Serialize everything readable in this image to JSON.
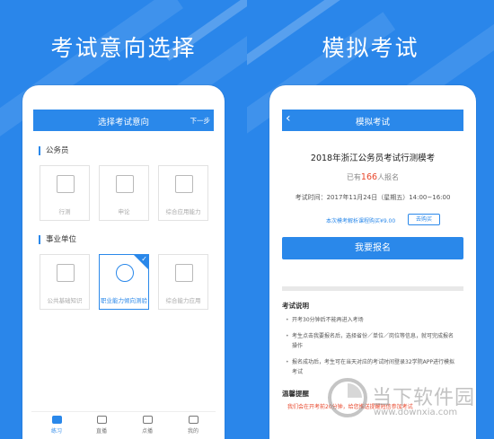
{
  "left_panel": {
    "headline": "考试意向选择",
    "header": {
      "title": "选择考试意向",
      "next": "下一步"
    },
    "section1": {
      "title": "公务员",
      "items": [
        {
          "label": "行测"
        },
        {
          "label": "申论"
        },
        {
          "label": "综合应用能力"
        }
      ]
    },
    "section2": {
      "title": "事业单位",
      "items": [
        {
          "label": "公共基础知识"
        },
        {
          "label": "职业能力倾向测验",
          "selected": true
        },
        {
          "label": "综合能力应用"
        }
      ]
    },
    "tabs": [
      {
        "label": "练习",
        "active": true
      },
      {
        "label": "直播"
      },
      {
        "label": "点播"
      },
      {
        "label": "我的"
      }
    ]
  },
  "right_panel": {
    "headline": "模拟考试",
    "header": {
      "title": "模拟考试",
      "back": "‹"
    },
    "exam_title": "2018年浙江公务员考试行测模考",
    "signup_prefix": "已有",
    "signup_count": "166",
    "signup_suffix": "人报名",
    "exam_time": "考试时间：2017年11月24日（星期五）14:00~16:00",
    "promo_text": "本次模考解析课程购买¥9.00",
    "buy_button": "去购买",
    "signup_button": "我要报名",
    "notes_title": "考试说明",
    "notes": [
      "开考30分钟后不能再进入考场",
      "考生点击我要报名后，选择省份／单位／岗位等信息，就可完成报名操作",
      "报名成功后，考生可在当天对应的考试时间登录32学院APP进行模拟考试"
    ],
    "tips_title": "温馨提醒",
    "tips_text": "我们会在开考前20分钟，给您推送提醒短信参加考试"
  },
  "watermark": {
    "brand": "当下软件园",
    "url": "www.downxia.com"
  },
  "colors": {
    "background": "#2a86ea",
    "accent": "#2a88ea",
    "highlight": "#e8472b"
  }
}
